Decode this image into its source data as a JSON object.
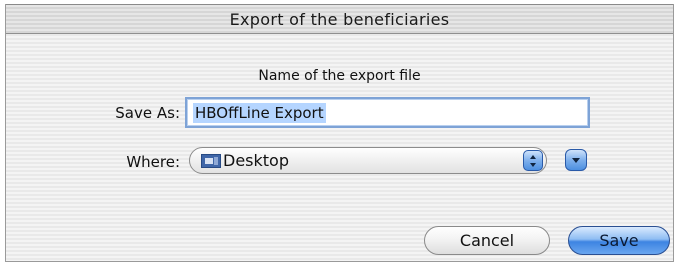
{
  "dialog": {
    "title": "Export of the beneficiaries",
    "subtitle": "Name of the export file",
    "save_as_label": "Save As:",
    "save_as_value": "HBOffLine Export",
    "where_label": "Where:",
    "where_value": "Desktop",
    "where_icon": "desktop-folder-icon",
    "cancel_label": "Cancel",
    "save_label": "Save",
    "accent_color": "#3d84e2"
  }
}
